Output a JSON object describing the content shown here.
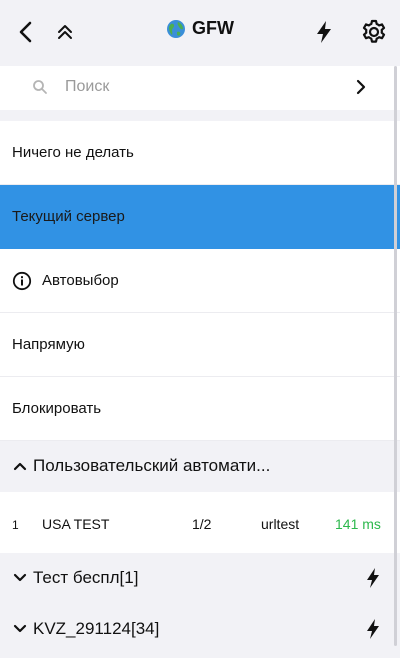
{
  "header": {
    "title": "GFW",
    "back_icon": "back-arrow-icon",
    "collapse_icon": "double-chevron-up-icon",
    "bolt_icon": "lightning-icon",
    "settings_icon": "gear-icon",
    "title_icon": "globe-icon"
  },
  "search": {
    "placeholder": "Поиск",
    "icon": "search-icon",
    "chevron_icon": "chevron-right-icon"
  },
  "options": [
    {
      "label": "Ничего не делать",
      "selected": false
    },
    {
      "label": "Текущий сервер",
      "selected": true
    },
    {
      "label": "Автовыбор",
      "selected": false,
      "icon": "info-icon"
    },
    {
      "label": "Напрямую",
      "selected": false
    },
    {
      "label": "Блокировать",
      "selected": false
    }
  ],
  "groups": [
    {
      "name": "Пользовательский автомати...",
      "expanded": true,
      "proxies": [
        {
          "index": "1",
          "name": "USA TEST",
          "count": "1/2",
          "type": "urltest",
          "latency": "141 ms"
        }
      ]
    },
    {
      "name": "Тест беспл[1]",
      "expanded": false
    },
    {
      "name": "KVZ_291124[34]",
      "expanded": false
    }
  ],
  "colors": {
    "selected_row": "#3192e4",
    "latency_good": "#2db84d",
    "background": "#f2f2f6"
  }
}
